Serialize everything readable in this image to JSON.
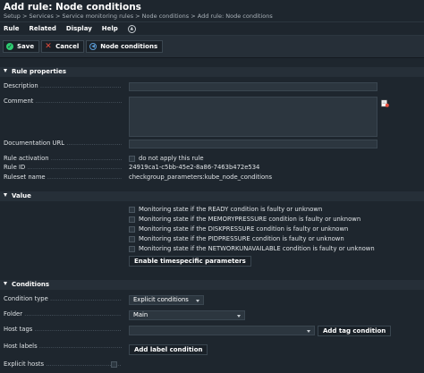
{
  "header": {
    "title": "Add rule: Node conditions",
    "breadcrumb": "Setup > Services > Service monitoring rules > Node conditions > Add rule: Node conditions"
  },
  "menu": {
    "items": [
      "Rule",
      "Related",
      "Display",
      "Help"
    ]
  },
  "toolbar": {
    "save_label": "Save",
    "cancel_label": "Cancel",
    "node_conditions_label": "Node conditions"
  },
  "rule_properties": {
    "section_label": "Rule properties",
    "description_label": "Description",
    "description_value": "",
    "comment_label": "Comment",
    "comment_value": "",
    "documentation_url_label": "Documentation URL",
    "documentation_url_value": "",
    "rule_activation_label": "Rule activation",
    "rule_activation_text": "do not apply this rule",
    "rule_id_label": "Rule ID",
    "rule_id_value": "24919ca1-c5bb-45e2-8a86-7463b472e534",
    "ruleset_name_label": "Ruleset name",
    "ruleset_name_value": "checkgroup_parameters:kube_node_conditions"
  },
  "value": {
    "section_label": "Value",
    "options": [
      "Monitoring state if the READY condition is faulty or unknown",
      "Monitoring state if the MEMORYPRESSURE condition is faulty or unknown",
      "Monitoring state if the DISKPRESSURE condition is faulty or unknown",
      "Monitoring state if the PIDPRESSURE condition is faulty or unknown",
      "Monitoring state if the NETWORKUNAVAILABLE condition is faulty or unknown"
    ],
    "timespecific_button": "Enable timespecific parameters"
  },
  "conditions": {
    "section_label": "Conditions",
    "condition_type_label": "Condition type",
    "condition_type_value": "Explicit conditions",
    "folder_label": "Folder",
    "folder_value": "Main",
    "host_tags_label": "Host tags",
    "host_tags_value": "",
    "add_tag_button": "Add tag condition",
    "host_labels_label": "Host labels",
    "add_label_button": "Add label condition",
    "explicit_hosts_label": "Explicit hosts"
  },
  "colors": {
    "background": "#1e262e",
    "section_header": "#262f38",
    "field": "#2c363f",
    "save_accent": "#2ecc71",
    "cancel_accent": "#e74c3c"
  }
}
